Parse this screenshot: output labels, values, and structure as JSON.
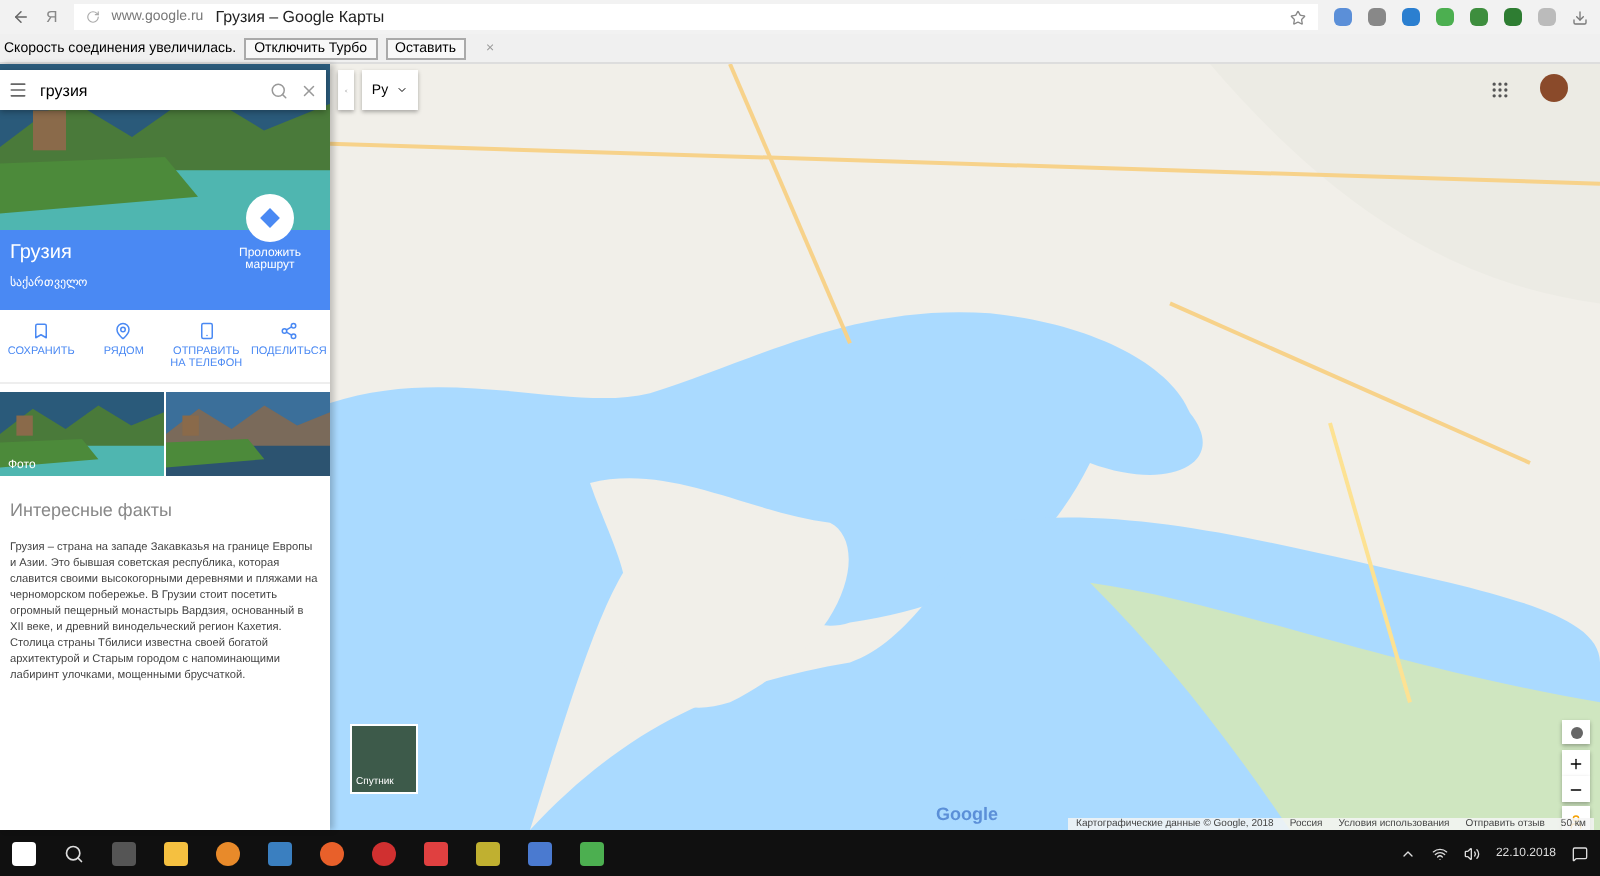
{
  "browser": {
    "url": "www.google.ru",
    "title": "Грузия – Google Карты",
    "logo": "Я"
  },
  "infobar": {
    "message": "Скорость соединения увеличилась.",
    "buttons": [
      "Отключить Турбо",
      "Оставить"
    ],
    "close": "×"
  },
  "search": {
    "value": "грузия"
  },
  "place": {
    "name": "Грузия",
    "native_name": "საქართველო",
    "directions": "Проложить маршрут"
  },
  "actions": [
    {
      "kind": "save",
      "label": "СОХРАНИТЬ"
    },
    {
      "kind": "nearby",
      "label": "РЯДОМ"
    },
    {
      "kind": "phone",
      "label": "ОТПРАВИТЬ НА ТЕЛЕФОН"
    },
    {
      "kind": "share",
      "label": "ПОДЕЛИТЬСЯ"
    }
  ],
  "photos": [
    {
      "kind": "picture",
      "caption": "Фото"
    },
    {
      "kind": "picture"
    }
  ],
  "facts": {
    "title": "Интересные факты",
    "text": "Грузия – страна на западе Закавказья на границе Европы и Азии. Это бывшая советская республика, которая славится своими высокогорными деревнями и пляжами на черноморском побережье. В Грузии стоит посетить огромный пещерный монастырь Вардзия, основанный в XII веке, и древний винодельческий регион Кахетия. Столица страны Тбилиси известна своей богатой архитектурой и Старым городом с напоминающими лабиринт улочками, мощенными брусчаткой."
  },
  "map": {
    "language": "Ру",
    "satellite": "Спутник",
    "logo": "Google",
    "attribution": [
      "Картографические данные © Google, 2018",
      "Россия",
      "Условия использования",
      "Отправить отзыв",
      "50 км"
    ]
  },
  "taskbar": {
    "date": "22.10.2018"
  }
}
